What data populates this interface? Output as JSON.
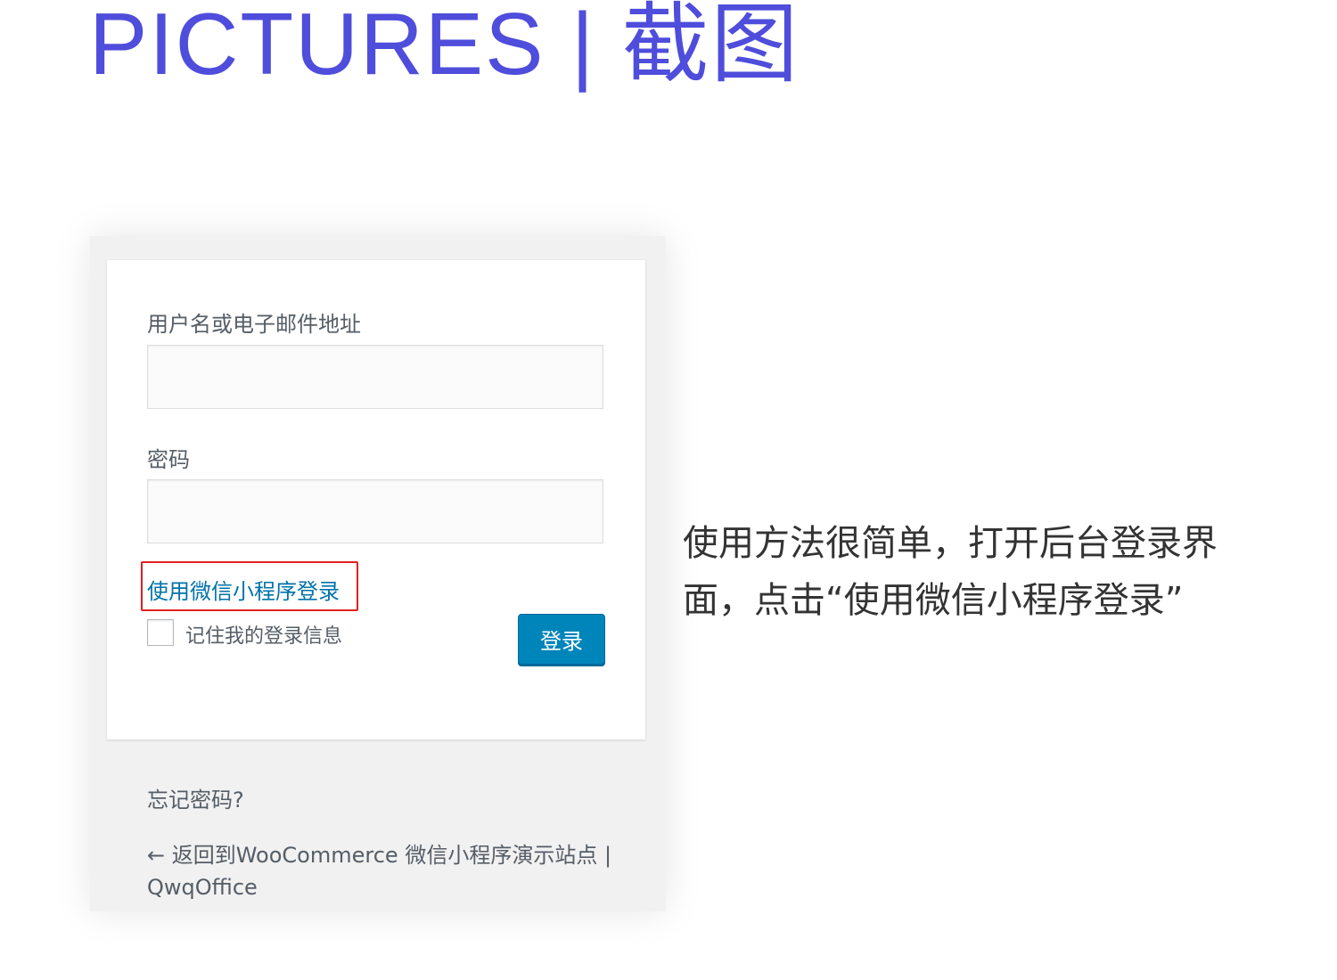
{
  "heading": "PICTURES | 截图",
  "login_form": {
    "username_label": "用户名或电子邮件地址",
    "username_value": "",
    "password_label": "密码",
    "password_value": "",
    "wechat_login_link": "使用微信小程序登录",
    "remember_me_label": "记住我的登录信息",
    "remember_me_checked": false,
    "submit_label": "登录",
    "highlight_color": "#e02020",
    "button_color": "#0085ba",
    "link_color": "#0073aa"
  },
  "footer_links": {
    "lost_password": "忘记密码?",
    "back_to_site": "← 返回到WooCommerce 微信小程序演示站点 | QwqOffice"
  },
  "description": "使用方法很简单，打开后台登录界面，点击“使用微信小程序登录”",
  "colors": {
    "heading": "#4f4ddb",
    "frame_background": "#f1f1f1"
  }
}
